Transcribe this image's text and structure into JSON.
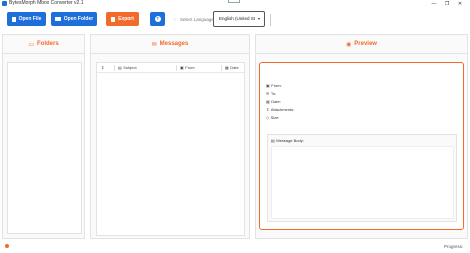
{
  "window": {
    "title": "BytesMorph Mbox Converter v2.1",
    "center_tag": "",
    "controls": {
      "minimize": "—",
      "maximize": "❐",
      "close": "✕"
    }
  },
  "toolbar": {
    "open_file": "Open File",
    "open_folder": "Open Folder",
    "export": "Export",
    "help": "?",
    "language_label": "Select Language",
    "language_value": "English (United St",
    "language_caret": "▾"
  },
  "panels": {
    "folders": {
      "title": "Folders",
      "icon": "folder-icon"
    },
    "messages": {
      "title": "Messages",
      "icon": "envelope-icon"
    },
    "preview": {
      "title": "Preview",
      "icon": "eye-icon"
    }
  },
  "messages_table": {
    "columns": [
      "",
      "Subject",
      "From",
      "Date"
    ]
  },
  "preview": {
    "from_label": "From:",
    "to_label": "To:",
    "date_label": "Date:",
    "attachments_label": "Attachments:",
    "size_label": "Size:",
    "body_label": "Message Body:"
  },
  "status": {
    "progress_label": "Progress:"
  },
  "colors": {
    "primary": "#1e6fd9",
    "accent": "#f26b2c"
  }
}
